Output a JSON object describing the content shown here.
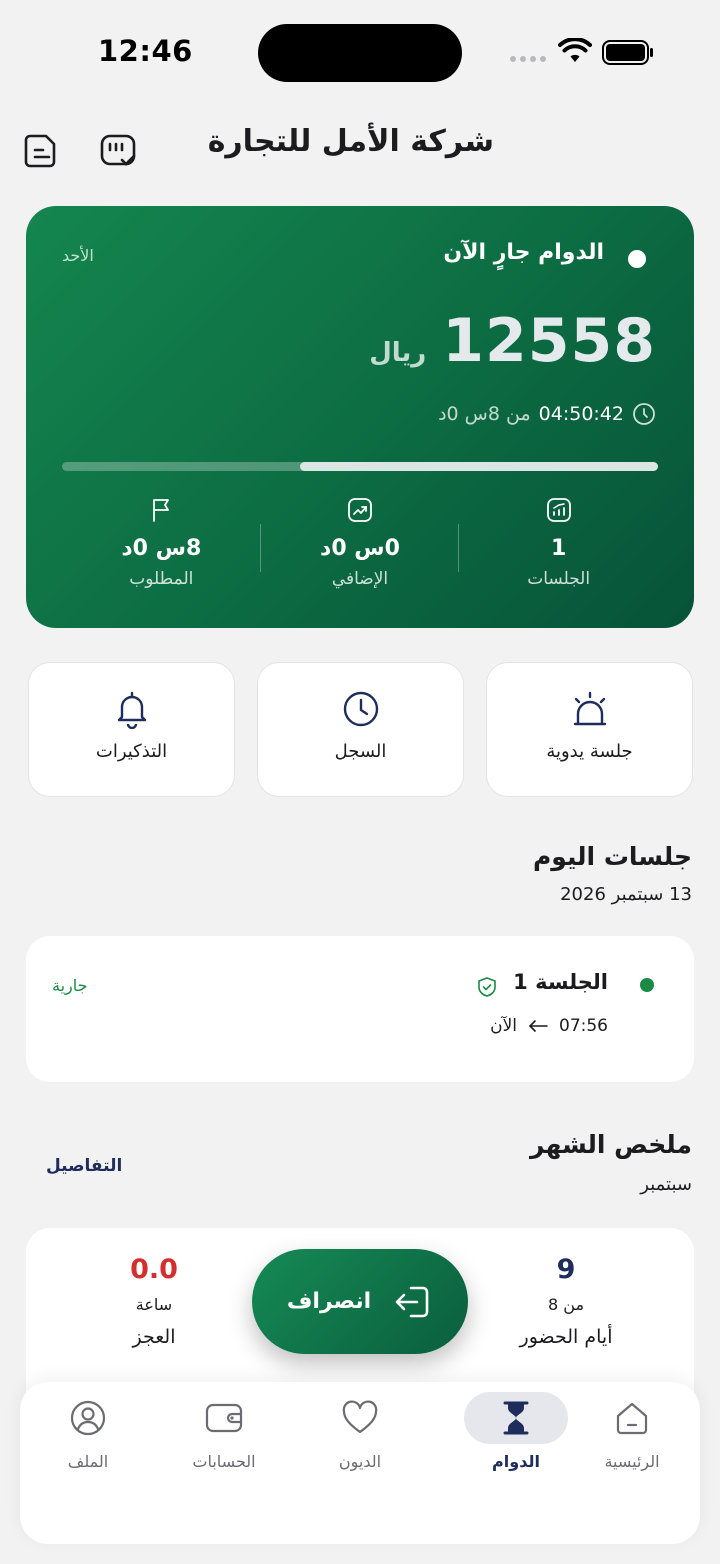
{
  "status_bar": {
    "time": "12:46"
  },
  "header": {
    "title": "شركة الأمل للتجارة"
  },
  "shift": {
    "status": "الدوام جارٍ الآن",
    "day": "الأحد",
    "earnings": "12558",
    "currency": "ريال",
    "elapsed": "04:50:42",
    "of_required": "من 8س 0د",
    "progress_percent": 60,
    "stats": [
      {
        "value": "1",
        "label": "الجلسات",
        "icon": "chart-icon"
      },
      {
        "value": "0س 0د",
        "label": "الإضافي",
        "icon": "trend-icon"
      },
      {
        "value": "8س 0د",
        "label": "المطلوب",
        "icon": "flag-icon"
      }
    ]
  },
  "quick_actions": [
    {
      "label": "جلسة يدوية",
      "icon": "alarm-light-icon"
    },
    {
      "label": "السجل",
      "icon": "clock-icon"
    },
    {
      "label": "التذكيرات",
      "icon": "bell-icon"
    }
  ],
  "today": {
    "title": "جلسات اليوم",
    "date": "13 سبتمبر 2026",
    "session": {
      "name": "الجلسة 1",
      "status": "جارية",
      "start": "07:56",
      "end": "الآن"
    }
  },
  "month": {
    "title": "ملخص الشهر",
    "subtitle": "سبتمبر",
    "details_label": "التفاصيل",
    "attendance": {
      "value": "9",
      "sub": "من 8",
      "label": "أيام الحضور"
    },
    "deficit": {
      "value": "0.0",
      "sub": "ساعة",
      "label": "العجز"
    }
  },
  "checkout": {
    "label": "انصراف"
  },
  "tabs": [
    {
      "label": "الرئيسية",
      "icon": "home-icon",
      "active": false
    },
    {
      "label": "الدوام",
      "icon": "hourglass-icon",
      "active": true
    },
    {
      "label": "الديون",
      "icon": "heart-icon",
      "active": false
    },
    {
      "label": "الحسابات",
      "icon": "wallet-icon",
      "active": false
    },
    {
      "label": "الملف",
      "icon": "user-icon",
      "active": false
    }
  ],
  "colors": {
    "brand_green": "#0c6b42",
    "navy": "#1f2d5c",
    "deficit_red": "#d32f2f",
    "live_green": "#1a8a45"
  }
}
